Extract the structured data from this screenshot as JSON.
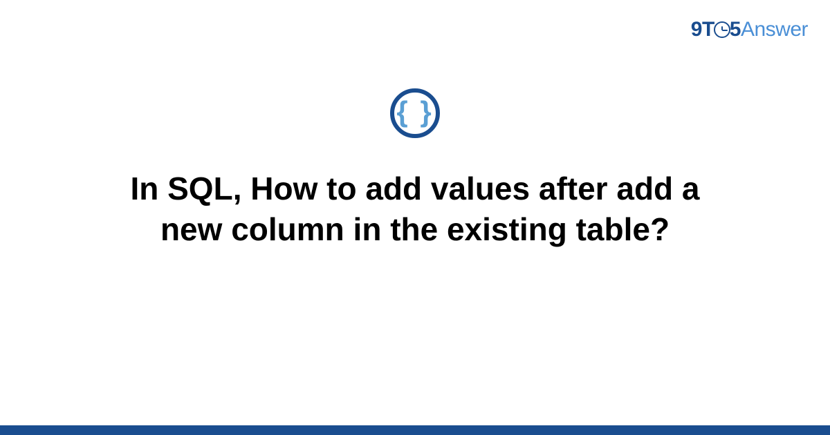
{
  "logo": {
    "nine": "9",
    "t": "T",
    "five": "5",
    "answer": "Answer"
  },
  "topic": {
    "icon_symbol": "{ }",
    "icon_name": "code-braces-icon"
  },
  "question": {
    "title": "In SQL, How to add values after add a new column in the existing table?"
  },
  "colors": {
    "primary_dark": "#1a4d8f",
    "primary_light": "#4a8fd6",
    "accent": "#5a9fd4"
  }
}
